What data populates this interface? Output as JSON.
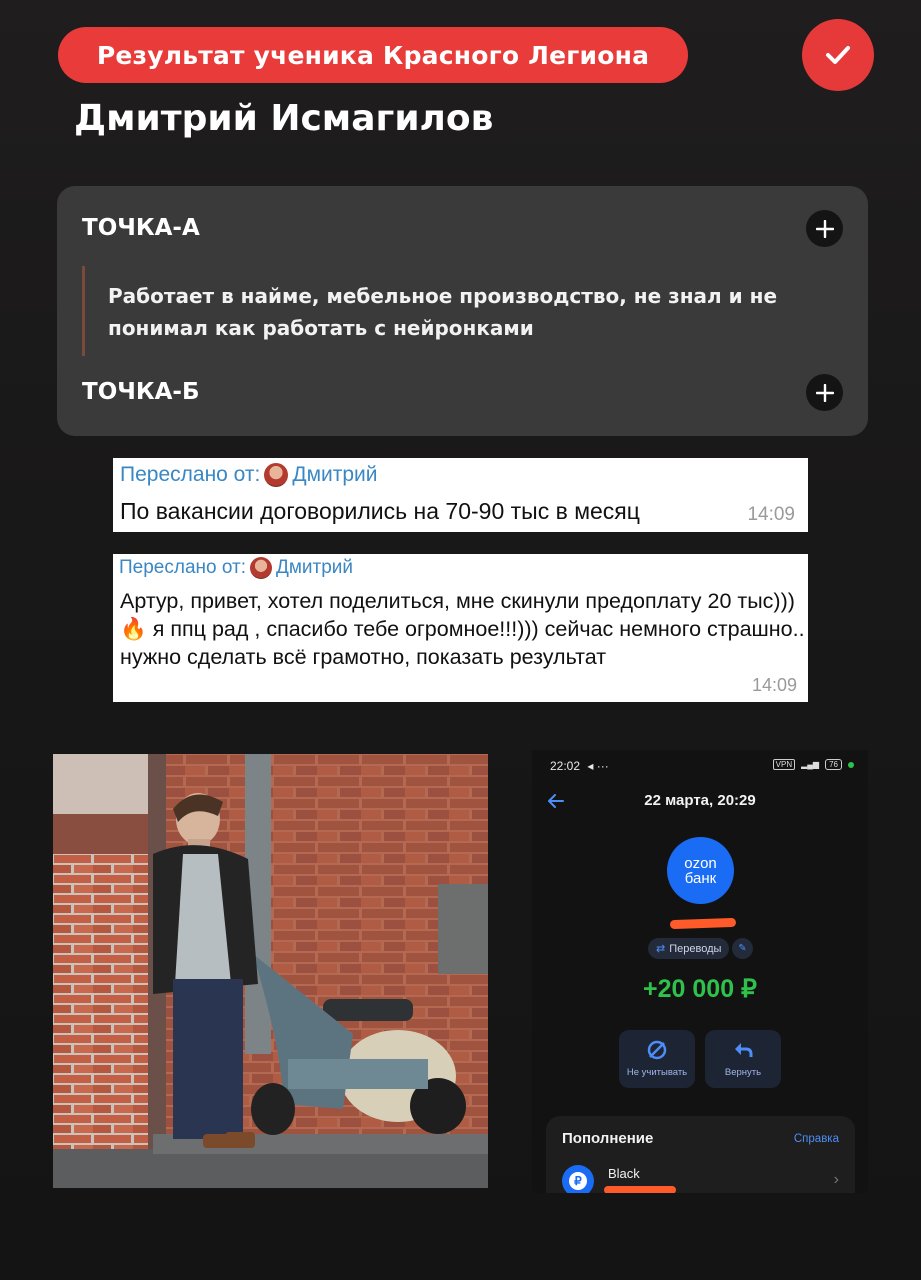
{
  "header": {
    "badge_text": "Результат ученика Красного Легиона",
    "student_name": "Дмитрий Исмагилов"
  },
  "points": {
    "a_title": "ТОЧКА-А",
    "a_text": "Работает в найме, мебельное производство, не знал и не понимал как работать с нейронками",
    "b_title": "ТОЧКА-Б"
  },
  "messages": [
    {
      "forwarded_label": "Переслано от:",
      "sender": "Дмитрий",
      "text": "По вакансии договорились на 70-90 тыс в месяц",
      "time": "14:09"
    },
    {
      "forwarded_label": "Переслано от:",
      "sender": "Дмитрий",
      "text_part1": "Артур, привет, хотел поделиться, мне скинули предоплату 20 тыс)))",
      "emoji": "🔥",
      "text_part2": "я ппц рад , спасибо тебе огромное!!!))) сейчас немного страшно.. нужно сделать всё грамотно, показать результат",
      "time": "14:09"
    }
  ],
  "phone": {
    "status_time": "22:02",
    "status_icons": "◂ ···",
    "vpn": "VPN",
    "battery": "76",
    "date": "22 марта, 20:29",
    "bank_logo_line1": "ozon",
    "bank_logo_line2": "банк",
    "category": "Переводы",
    "amount": "+20 000 ₽",
    "action_ignore": "Не учитывать",
    "action_return": "Вернуть",
    "section_title": "Пополнение",
    "help_link": "Справка",
    "account_name": "Black",
    "colors": {
      "accent": "#1a6cf5",
      "amount": "#2fc24a",
      "redaction": "#ff5a2a"
    }
  },
  "colors": {
    "badge": "#ea3b3b",
    "card": "#3a3a3a",
    "forward_link": "#3a87c4"
  }
}
